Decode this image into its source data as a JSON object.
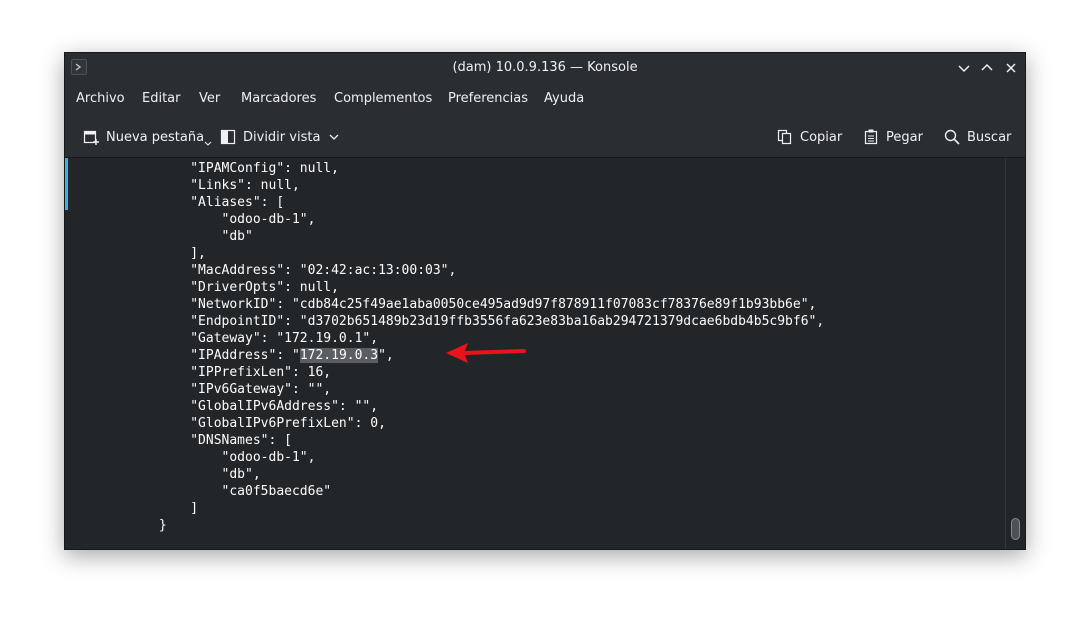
{
  "window": {
    "title": "(dam) 10.0.9.136 — Konsole"
  },
  "icons": {
    "app": "konsole-terminal-icon",
    "minimize": "chevron-down-icon",
    "maximize": "chevron-up-icon",
    "close": "close-icon"
  },
  "menu": [
    {
      "label": "Archivo"
    },
    {
      "label": "Editar"
    },
    {
      "label": "Ver"
    },
    {
      "label": "Marcadores"
    },
    {
      "label": "Complementos"
    },
    {
      "label": "Preferencias"
    },
    {
      "label": "Ayuda"
    }
  ],
  "toolbar": {
    "new_tab": "Nueva pestaña",
    "split_view": "Dividir vista",
    "copy": "Copiar",
    "paste": "Pegar",
    "search": "Buscar"
  },
  "terminal": {
    "lines": [
      "                \"IPAMConfig\": null,",
      "                \"Links\": null,",
      "                \"Aliases\": [",
      "                    \"odoo-db-1\",",
      "                    \"db\"",
      "                ],",
      "                \"MacAddress\": \"02:42:ac:13:00:03\",",
      "                \"DriverOpts\": null,",
      "                \"NetworkID\": \"cdb84c25f49ae1aba0050ce495ad9d97f878911f07083cf78376e89f1b93bb6e\",",
      "                \"EndpointID\": \"d3702b651489b23d19ffb3556fa623e83ba16ab294721379dcae6bdb4b5c9bf6\",",
      "                \"Gateway\": \"172.19.0.1\",",
      "                \"IPPrefixLen\": 16,",
      "                \"IPv6Gateway\": \"\",",
      "                \"GlobalIPv6Address\": \"\",",
      "                \"GlobalIPv6PrefixLen\": 0,",
      "                \"DNSNames\": [",
      "                    \"odoo-db-1\",",
      "                    \"db\",",
      "                    \"ca0f5baecd6e\"",
      "                ]",
      "            }"
    ],
    "ip_line": {
      "prefix": "                \"IPAddress\": \"",
      "selected": "172.19.0.3",
      "suffix": "\","
    }
  },
  "colors": {
    "background": "#232629",
    "accent": "#3daee9",
    "annotation_arrow": "#e8141c"
  }
}
